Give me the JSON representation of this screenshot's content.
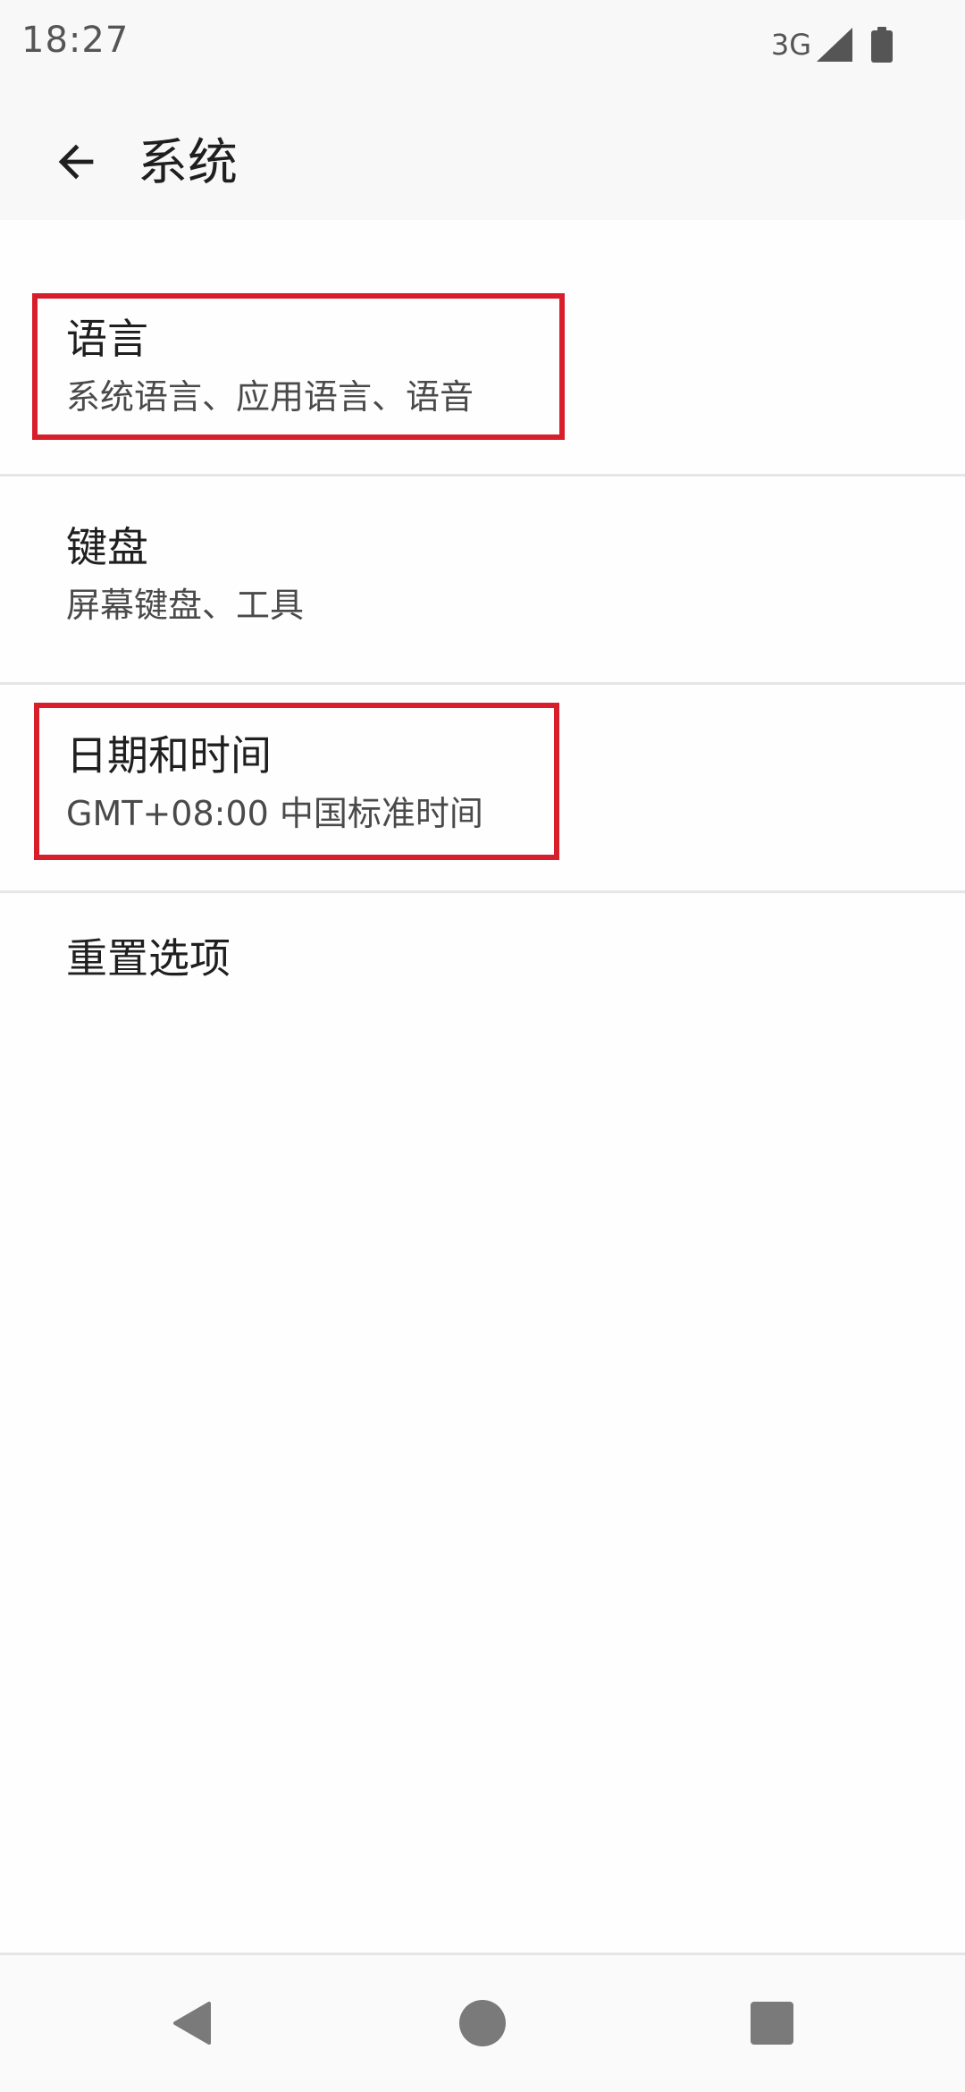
{
  "status_bar": {
    "time": "18:27",
    "network_type": "3G",
    "icons": [
      "signal-icon",
      "battery-icon"
    ]
  },
  "app_bar": {
    "title": "系统",
    "back_icon": "arrow-left-icon"
  },
  "list": {
    "items": [
      {
        "title": "语言",
        "summary": "系统语言、应用语言、语音"
      },
      {
        "title": "键盘",
        "summary": "屏幕键盘、工具"
      },
      {
        "title": "日期和时间",
        "summary": "GMT+08:00 中国标准时间"
      },
      {
        "title": "重置选项"
      }
    ]
  },
  "nav_bar": {
    "icons": [
      "nav-back-icon",
      "nav-home-icon",
      "nav-recents-icon"
    ]
  },
  "colors": {
    "highlight": "#d71f2b",
    "background": "#fefefe",
    "text_primary": "#1f1f1f",
    "text_secondary": "#4a4a4a"
  }
}
